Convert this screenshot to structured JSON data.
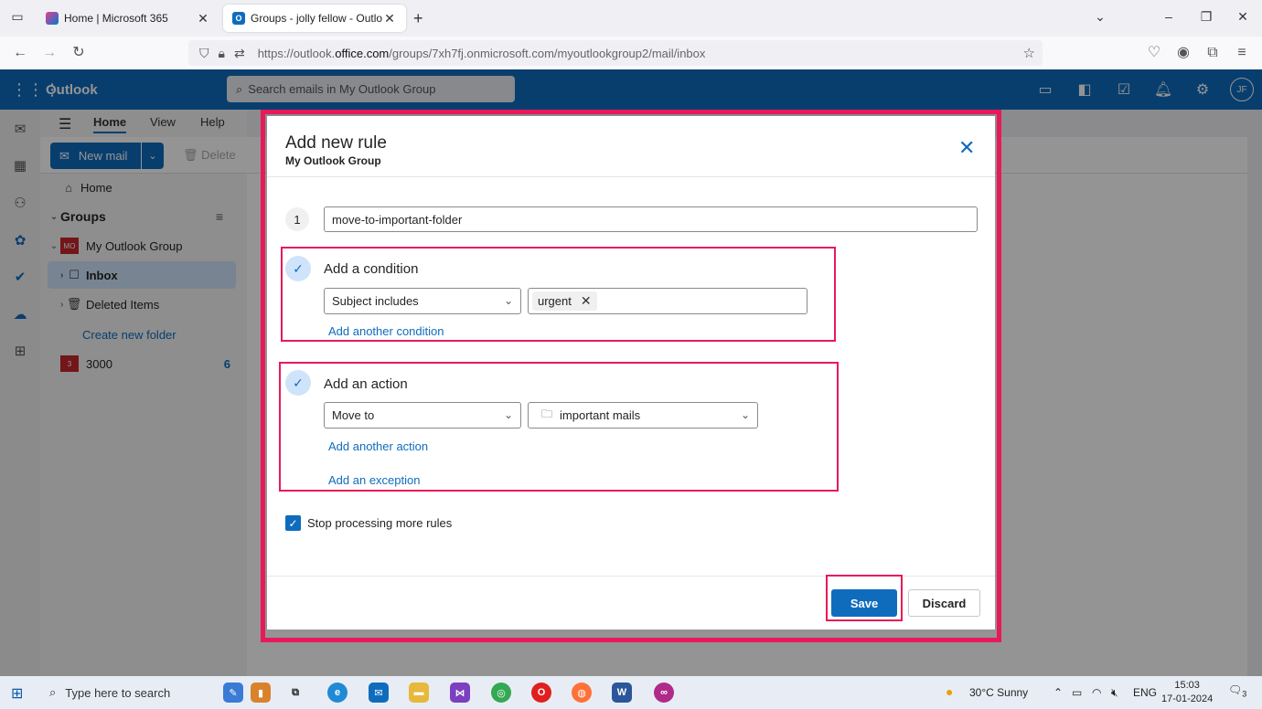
{
  "browser": {
    "tabs": [
      {
        "title": "Home | Microsoft 365",
        "active": false
      },
      {
        "title": "Groups - jolly fellow - Outlook",
        "active": true
      }
    ],
    "url_prefix": "https://outlook.",
    "url_domain": "office.com",
    "url_path": "/groups/7xh7fj.onmicrosoft.com/myoutlookgroup2/mail/inbox"
  },
  "outlook": {
    "app_title": "Outlook",
    "search_placeholder": "Search emails in My Outlook Group",
    "avatar_initials": "JF",
    "ribbon_tabs": [
      "Home",
      "View",
      "Help"
    ],
    "new_mail_label": "New mail",
    "delete_label": "Delete"
  },
  "folders": {
    "home": "Home",
    "groups_header": "Groups",
    "group_name": "My Outlook Group",
    "group_badge": "MO",
    "inbox": "Inbox",
    "deleted": "Deleted Items",
    "create_folder": "Create new folder",
    "other_group": "3000",
    "other_group_badge": "3",
    "other_group_count": "6"
  },
  "modal": {
    "title": "Add new rule",
    "subtitle": "My Outlook Group",
    "step_number": "1",
    "rule_name": "move-to-important-folder",
    "condition": {
      "label": "Add a condition",
      "type": "Subject includes",
      "tag": "urgent",
      "add_another": "Add another condition"
    },
    "action": {
      "label": "Add an action",
      "type": "Move to",
      "folder": "important mails",
      "add_another": "Add another action",
      "add_exception": "Add an exception"
    },
    "stop_processing": "Stop processing more rules",
    "stop_processing_checked": true,
    "save_label": "Save",
    "discard_label": "Discard"
  },
  "taskbar": {
    "search_placeholder": "Type here to search",
    "weather": "30°C  Sunny",
    "language": "ENG",
    "time": "15:03",
    "date": "17-01-2024",
    "notification_count": "3"
  },
  "colors": {
    "accent": "#0f6cbd",
    "highlight": "#e8195a"
  }
}
